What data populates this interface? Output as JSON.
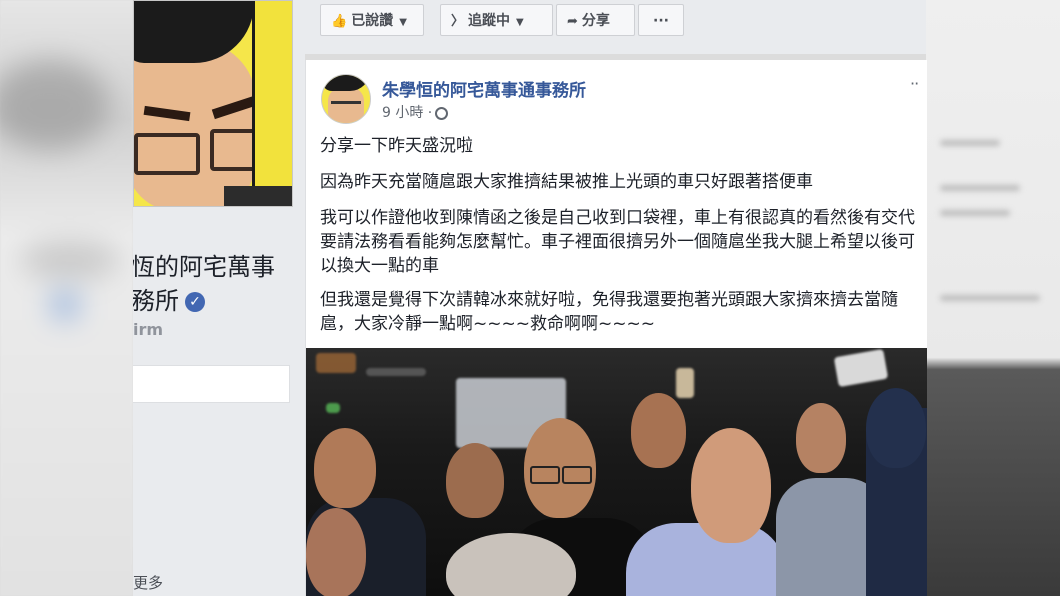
{
  "left": {
    "page_name_line1": "恆的阿宅萬事",
    "page_name_line2": "務所",
    "category_fragment": "irm",
    "more_link": "更多"
  },
  "actions": {
    "like_label": "已說讚",
    "follow_label": "追蹤中",
    "share_label": "分享",
    "more_label": "···"
  },
  "post": {
    "author": "朱學恒的阿宅萬事通事務所",
    "time": "9 小時 ·",
    "menu": "··",
    "paragraphs": [
      "分享一下昨天盛況啦",
      "因為昨天充當隨扈跟大家推擠結果被推上光頭的車只好跟著搭便車",
      "我可以作證他收到陳情函之後是自己收到口袋裡，車上有很認真的看然後有交代要請法務看看能夠怎麼幫忙。車子裡面很擠另外一個隨扈坐我大腿上希望以後可以換大一點的車",
      "但我還是覺得下次請韓冰來就好啦，免得我還要抱著光頭跟大家擠來擠去當隨扈，大家冷靜一點啊~~~~救命啊啊~~~~"
    ]
  },
  "colors": {
    "link_blue": "#365899",
    "text": "#1d2129",
    "meta_gray": "#616770",
    "verified_blue": "#4267b2",
    "avatar_yellow": "#f5e64a"
  },
  "icons": {
    "like": "thumbs-up-icon",
    "follow": "rss-icon",
    "share": "share-arrow-icon",
    "privacy": "globe-icon",
    "verified": "verified-check-icon"
  }
}
